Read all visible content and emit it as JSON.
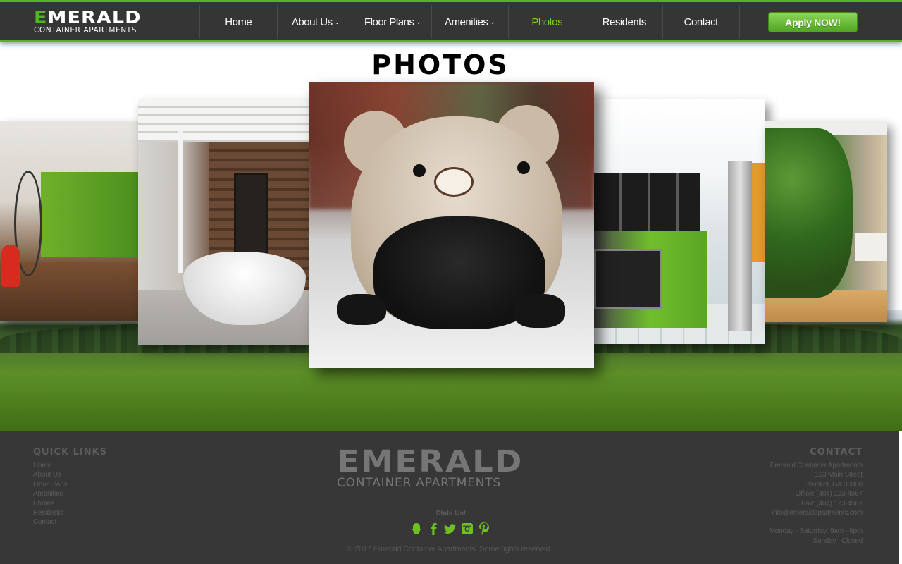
{
  "header": {
    "logo": {
      "main_first": "E",
      "main_rest": "MERALD",
      "sub": "CONTAINER APARTMENTS"
    },
    "nav": [
      {
        "label": "Home",
        "dropdown": false
      },
      {
        "label": "About Us",
        "dropdown": true
      },
      {
        "label": "Floor Plans",
        "dropdown": true
      },
      {
        "label": "Amenities",
        "dropdown": true
      },
      {
        "label": "Photos",
        "dropdown": false,
        "active": true
      },
      {
        "label": "Residents",
        "dropdown": false
      },
      {
        "label": "Contact",
        "dropdown": false
      }
    ],
    "apply_label": "Apply NOW!"
  },
  "main": {
    "title": "PHOTOS",
    "gallery": [
      {
        "subject": "container loft with spiral stair"
      },
      {
        "subject": "bathroom with freestanding tub"
      },
      {
        "subject": "puppy in bear hoodie",
        "featured": true
      },
      {
        "subject": "green kitchen"
      },
      {
        "subject": "living plant wall"
      }
    ]
  },
  "footer": {
    "quick_links_heading": "QUICK LINKS",
    "quick_links": [
      "Home",
      "About Us",
      "Floor Plans",
      "Amenities",
      "Photos",
      "Residents",
      "Contact"
    ],
    "logo": {
      "main": "EMERALD",
      "sub": "CONTAINER APARTMENTS"
    },
    "stalk_label": "Stalk Us!",
    "socials": [
      "snapchat-icon",
      "facebook-icon",
      "twitter-icon",
      "instagram-icon",
      "pinterest-icon"
    ],
    "copyright": "© 2017 Emerald Container Apartments. Some rights reserved.",
    "contact_heading": "CONTACT",
    "contact_lines": [
      "Emerald Container Apartments",
      "123 Main Street",
      "Phucket, GA 30000",
      "Office: (404) 123-4567",
      "Fax: (404) 123-4567",
      "info@emeraldapartments.com"
    ],
    "hours": [
      "Monday - Saturday: 9am - 6pm",
      "Sunday : Closed"
    ]
  },
  "colors": {
    "accent": "#4fb81c",
    "active_nav": "#7ed321",
    "nav_bg": "#353535",
    "footer_bg": "#373737"
  }
}
